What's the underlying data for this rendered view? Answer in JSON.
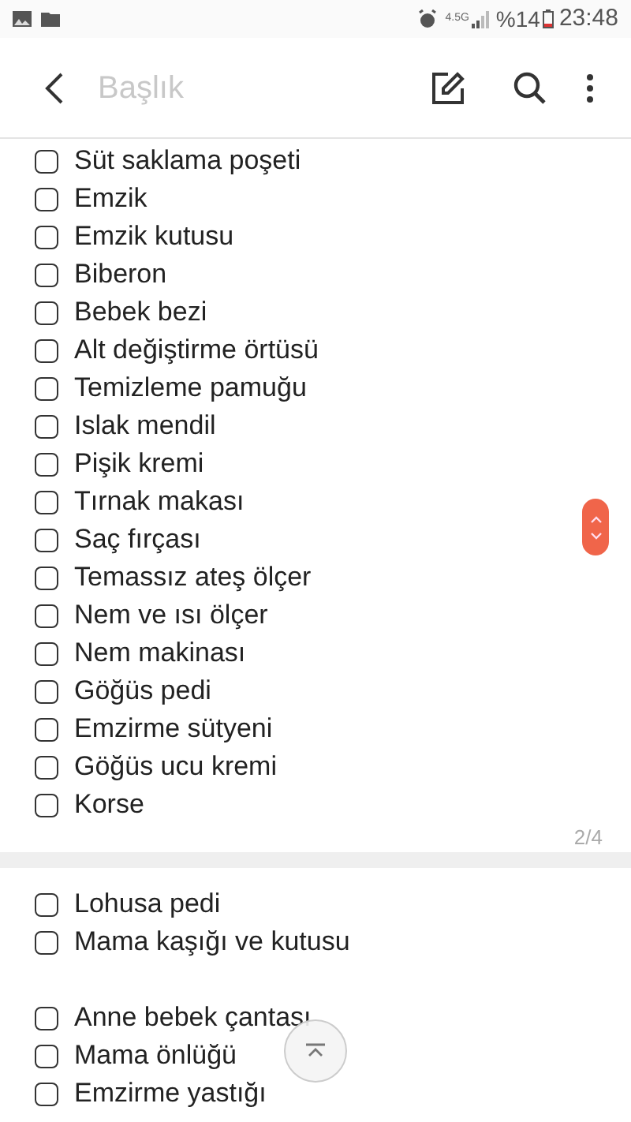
{
  "status_bar": {
    "battery": "%14",
    "time": "23:48",
    "network": "4.5G"
  },
  "toolbar": {
    "title_placeholder": "Başlık"
  },
  "pages": [
    {
      "items": [
        {
          "label": "Süt saklama poşeti",
          "checked": false
        },
        {
          "label": "Emzik",
          "checked": false
        },
        {
          "label": "Emzik kutusu",
          "checked": false
        },
        {
          "label": "Biberon",
          "checked": false
        },
        {
          "label": "Bebek bezi",
          "checked": false
        },
        {
          "label": "Alt değiştirme örtüsü",
          "checked": false
        },
        {
          "label": "Temizleme pamuğu",
          "checked": false
        },
        {
          "label": "Islak mendil",
          "checked": false
        },
        {
          "label": "Pişik kremi",
          "checked": false
        },
        {
          "label": "Tırnak makası",
          "checked": false
        },
        {
          "label": "Saç fırçası",
          "checked": false
        },
        {
          "label": "Temassız ateş ölçer",
          "checked": false
        },
        {
          "label": "Nem ve ısı ölçer",
          "checked": false
        },
        {
          "label": "Nem makinası",
          "checked": false
        },
        {
          "label": "Göğüs pedi",
          "checked": false
        },
        {
          "label": "Emzirme sütyeni",
          "checked": false
        },
        {
          "label": "Göğüs ucu kremi",
          "checked": false
        },
        {
          "label": "Korse",
          "checked": false
        }
      ],
      "page_number": "2/4"
    },
    {
      "items": [
        {
          "label": "Lohusa pedi",
          "checked": false
        },
        {
          "label": "Mama kaşığı ve kutusu",
          "checked": false
        },
        {
          "kind": "blank"
        },
        {
          "label": "Anne bebek çantası",
          "checked": false
        },
        {
          "label": "Mama önlüğü",
          "checked": false
        },
        {
          "label": "Emzirme yastığı",
          "checked": false
        }
      ]
    }
  ]
}
